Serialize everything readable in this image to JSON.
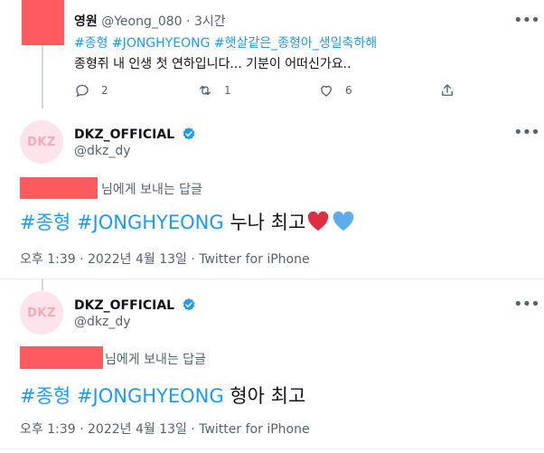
{
  "tweet1": {
    "name": "영원",
    "handle": "@Yeong_080",
    "sep": "·",
    "time": "3시간",
    "hashtags": [
      "#종형",
      "#JONGHYEONG",
      "#햇살같은_종형아_생일축하해"
    ],
    "body": "종형쥐 내 인생 첫 연하입니다... 기분이 어떠신가요..",
    "reply_count": "2",
    "retweet_count": "1",
    "like_count": "6"
  },
  "reply1": {
    "avatar_text": "DKZ",
    "name": "DKZ_OFFICIAL",
    "handle": "@dkz_dy",
    "replying_to_suffix": "님에게 보내는 답글",
    "hashtags": [
      "#종형",
      "#JONGHYEONG"
    ],
    "text": "누나 최고",
    "emoji": "❤️💙",
    "timestamp": "오후 1:39 · 2022년 4월 13일 · Twitter for iPhone"
  },
  "reply2": {
    "avatar_text": "DKZ",
    "name": "DKZ_OFFICIAL",
    "handle": "@dkz_dy",
    "replying_to_suffix": "님에게 보내는 답글",
    "hashtags": [
      "#종형",
      "#JONGHYEONG"
    ],
    "text": "형아 최고",
    "timestamp": "오후 1:39 · 2022년 4월 13일 · Twitter for iPhone"
  },
  "icons": {
    "reply": "reply-icon",
    "retweet": "retweet-icon",
    "like": "like-icon",
    "share": "share-icon",
    "more": "more-icon",
    "verified": "verified-badge-icon"
  },
  "colors": {
    "accent": "#1d9bf0",
    "redaction": "#ff5a5f",
    "secondary_text": "#536471"
  }
}
